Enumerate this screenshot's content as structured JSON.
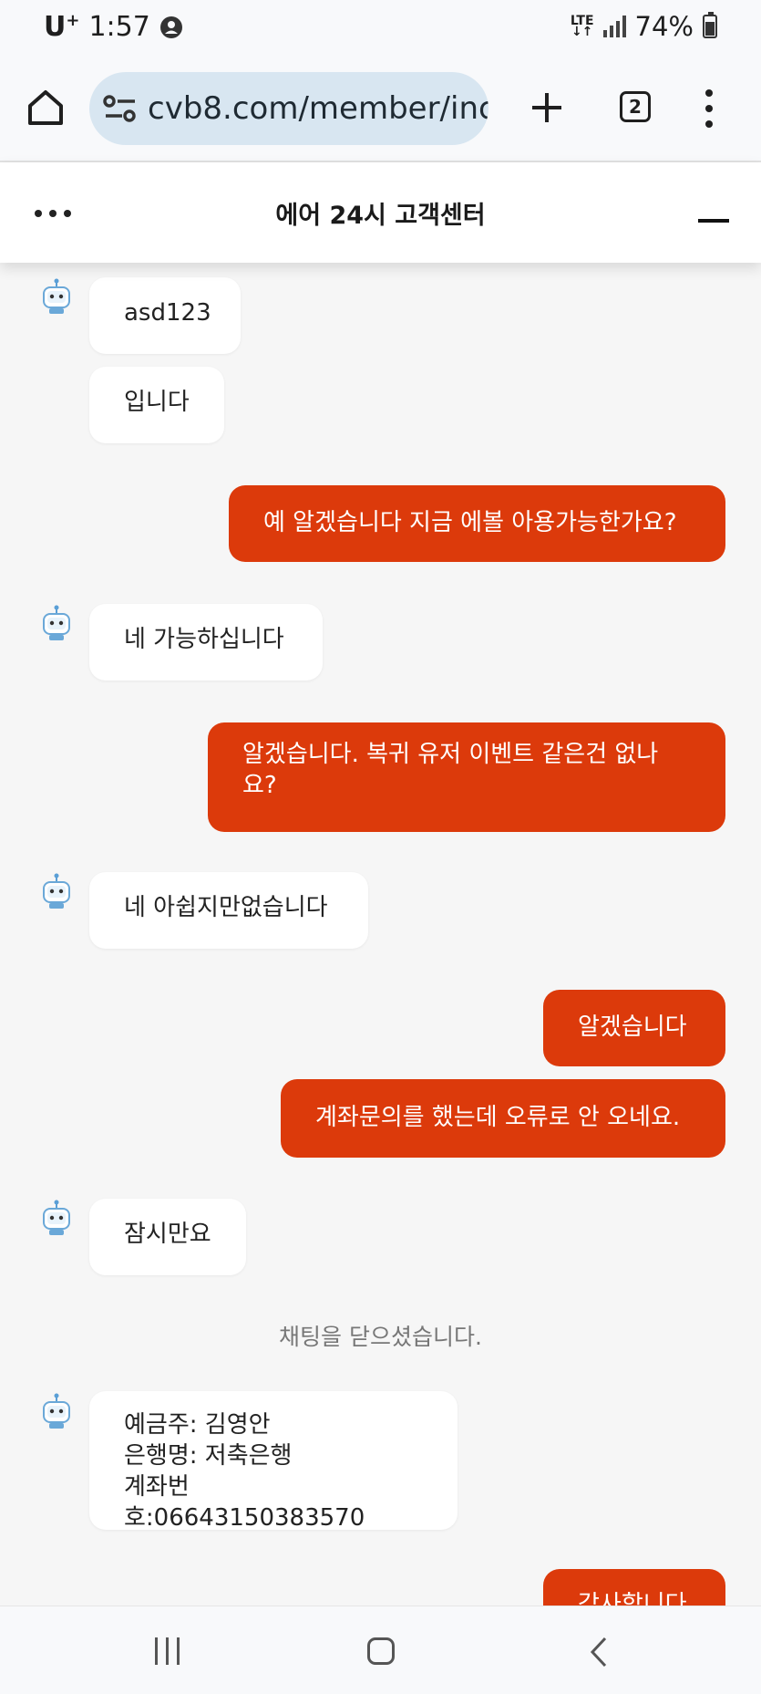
{
  "status_bar": {
    "carrier": "U",
    "carrier_sup": "+",
    "time": "1:57",
    "network": "LTE",
    "battery": "74%"
  },
  "browser": {
    "url": "cvb8.com/member/inc",
    "tab_count": "2"
  },
  "chat": {
    "title": "에어 24시 고객센터",
    "messages": [
      {
        "from": "bot",
        "text": "asd123"
      },
      {
        "from": "bot",
        "text": "입니다"
      },
      {
        "from": "user",
        "text": "예 알겠습니다 지금 에볼 아용가능한가요?"
      },
      {
        "from": "bot",
        "text": "네 가능하십니다"
      },
      {
        "from": "user",
        "line1": "알겠습니다. 복귀 유저 이벤트 같은건 없나",
        "line2": "요?"
      },
      {
        "from": "bot",
        "text": "네 아쉽지만없습니다"
      },
      {
        "from": "user",
        "text": "알겠습니다"
      },
      {
        "from": "user",
        "text": "계좌문의를 했는데 오류로 안 오네요."
      },
      {
        "from": "bot",
        "text": "잠시만요"
      },
      {
        "from": "system",
        "text": "채팅을 닫으셨습니다."
      },
      {
        "from": "bot",
        "line1": "예금주: 김영안",
        "line2": "은행명: 저축은행",
        "line3": "계좌번호:06643150383570"
      },
      {
        "from": "user",
        "text": "감사합니다"
      }
    ]
  },
  "colors": {
    "user_bubble": "#dc3a0b",
    "bot_bubble": "#ffffff",
    "chat_background": "#f6f6f6"
  },
  "icons": [
    "home-icon",
    "site-settings-icon",
    "plus-icon",
    "tab-switcher-icon",
    "more-vert-icon",
    "more-horiz-icon",
    "minimize-icon",
    "bot-avatar-icon",
    "nav-recent-icon",
    "nav-home-icon",
    "nav-back-icon"
  ]
}
